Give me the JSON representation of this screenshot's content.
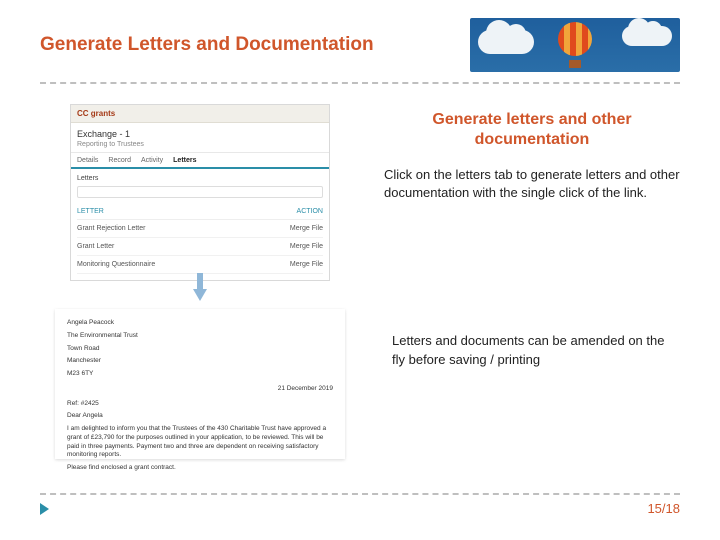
{
  "title": "Generate Letters and Documentation",
  "section": {
    "heading": "Generate letters and other documentation",
    "para1": "Click on the letters tab to generate letters and other documentation with the single click of the link.",
    "para2": "Letters and documents can be amended on the fly before saving / printing"
  },
  "screenshot": {
    "brand": "CC grants",
    "exchange": "Exchange - 1",
    "subline1": "Reporting to Trustees",
    "tabs": [
      "Details",
      "Record",
      "Activity",
      "Letters"
    ],
    "active_tab": "Letters",
    "letters_label": "Letters",
    "cols": {
      "left": "LETTER",
      "right": "ACTION"
    },
    "rows": [
      {
        "name": "Grant Rejection Letter",
        "action": "Merge File"
      },
      {
        "name": "Grant Letter",
        "action": "Merge File"
      },
      {
        "name": "Monitoring Questionnaire",
        "action": "Merge File"
      }
    ]
  },
  "letter": {
    "addr1": "Angela Peacock",
    "addr2": "The Environmental Trust",
    "addr3": "Town Road",
    "addr4": "Manchester",
    "addr5": "M23 6TY",
    "date": "21 December 2019",
    "ref": "Ref: #2425",
    "greeting": "Dear Angela",
    "body": "I am delighted to inform you that the Trustees of the 430 Charitable Trust have approved a grant of £23,790 for the purposes outlined in your application, to be reviewed. This will be paid in three payments. Payment two and three are dependent on receiving satisfactory monitoring reports.",
    "close": "Please find enclosed a grant contract."
  },
  "footer": {
    "page": "15/18"
  }
}
